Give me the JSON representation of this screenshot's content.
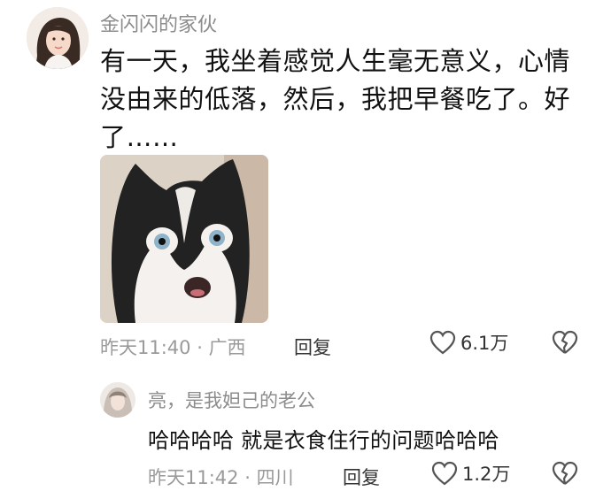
{
  "main_comment": {
    "username": "金闪闪的家伙",
    "text": "有一天，我坐着感觉人生毫无意义，心情没由来的低落，然后，我把早餐吃了。好了……",
    "timestamp": "昨天11:40",
    "location": "广西",
    "reply_label": "回复",
    "likes": "6.1万"
  },
  "reply_comment": {
    "username": "亮，是我妲己的老公",
    "text": "哈哈哈哈 就是衣食住行的问题哈哈哈",
    "timestamp": "昨天11:42",
    "location": "四川",
    "reply_label": "回复",
    "likes": "1.2万"
  },
  "separator": " · ",
  "colors": {
    "meta_gray": "#9a9a9a",
    "username_gray": "#8c8c8c",
    "text_black": "#111111"
  },
  "icons": {
    "like": "heart-outline-icon",
    "dislike": "broken-heart-icon"
  }
}
